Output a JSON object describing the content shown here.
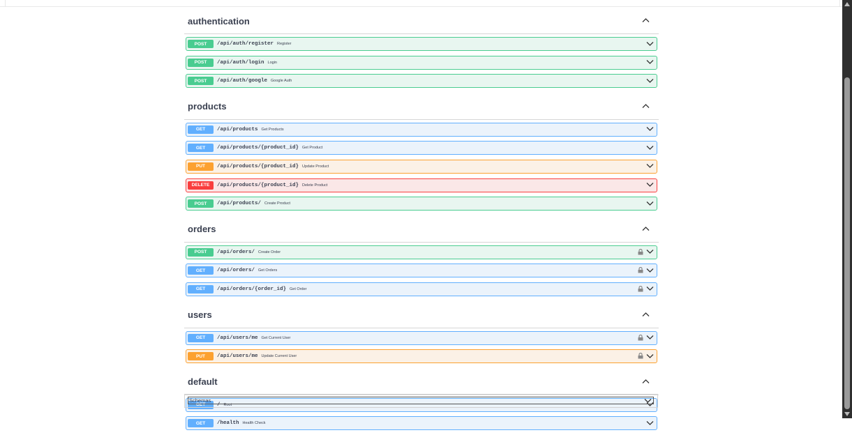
{
  "sections": [
    {
      "name": "authentication",
      "ops": [
        {
          "method": "POST",
          "path": "/api/auth/register",
          "summary": "Register",
          "lock": false
        },
        {
          "method": "POST",
          "path": "/api/auth/login",
          "summary": "Login",
          "lock": false
        },
        {
          "method": "POST",
          "path": "/api/auth/google",
          "summary": "Google Auth",
          "lock": false
        }
      ]
    },
    {
      "name": "products",
      "ops": [
        {
          "method": "GET",
          "path": "/api/products",
          "summary": "Get Products",
          "lock": false
        },
        {
          "method": "GET",
          "path": "/api/products/{product_id}",
          "summary": "Get Product",
          "lock": false
        },
        {
          "method": "PUT",
          "path": "/api/products/{product_id}",
          "summary": "Update Product",
          "lock": false
        },
        {
          "method": "DELETE",
          "path": "/api/products/{product_id}",
          "summary": "Delete Product",
          "lock": false
        },
        {
          "method": "POST",
          "path": "/api/products/",
          "summary": "Create Product",
          "lock": false
        }
      ]
    },
    {
      "name": "orders",
      "ops": [
        {
          "method": "POST",
          "path": "/api/orders/",
          "summary": "Create Order",
          "lock": true
        },
        {
          "method": "GET",
          "path": "/api/orders/",
          "summary": "Get Orders",
          "lock": true
        },
        {
          "method": "GET",
          "path": "/api/orders/{order_id}",
          "summary": "Get Order",
          "lock": true
        }
      ]
    },
    {
      "name": "users",
      "ops": [
        {
          "method": "GET",
          "path": "/api/users/me",
          "summary": "Get Current User",
          "lock": true
        },
        {
          "method": "PUT",
          "path": "/api/users/me",
          "summary": "Update Current User",
          "lock": true
        }
      ]
    },
    {
      "name": "default",
      "ops": [
        {
          "method": "GET",
          "path": "/",
          "summary": "Root",
          "lock": false
        },
        {
          "method": "GET",
          "path": "/health",
          "summary": "Health Check",
          "lock": false
        }
      ]
    }
  ],
  "schemas": {
    "label": "Schemas"
  },
  "icons": {
    "section_toggle": "chevron-up-icon",
    "op_toggle": "chevron-down-icon",
    "lock": "lock-icon"
  },
  "colors": {
    "POST": "#49cc90",
    "GET": "#61affe",
    "PUT": "#fca130",
    "DELETE": "#f93e3e",
    "text": "#3b4151"
  }
}
